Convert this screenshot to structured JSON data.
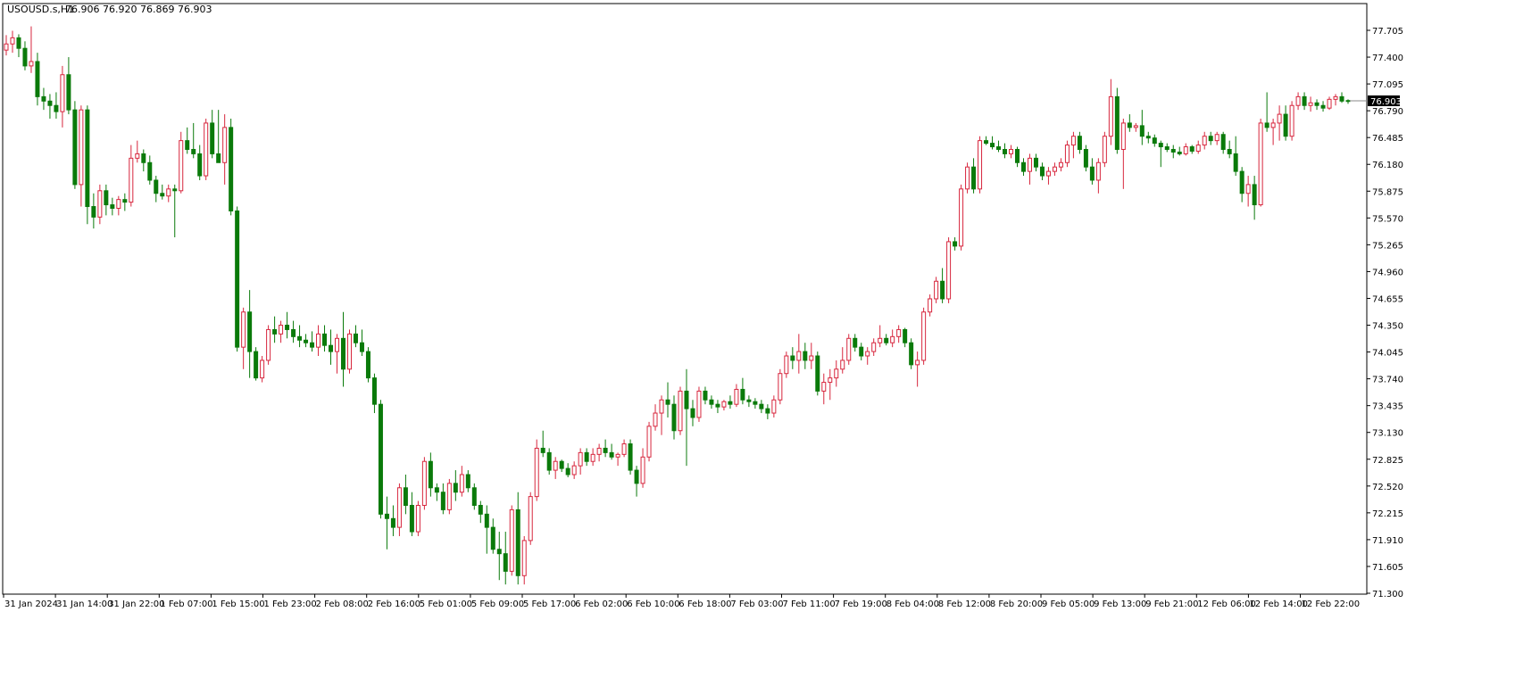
{
  "header": {
    "symbol": "USOUSD.s,H1",
    "ohlc": "76.906 76.920 76.869 76.903"
  },
  "colors": {
    "bull_body": "#ffffff",
    "bull_outline": "#d7263d",
    "bear_body": "#0a7a0a",
    "bear_outline": "#0a7a0a",
    "frame": "#000000",
    "price_tag_bg": "#000000",
    "price_tag_text": "#ffffff"
  },
  "chart_data": {
    "type": "candlestick",
    "title": "USOUSD.s,H1",
    "current_price_label": "76.903",
    "ylim": [
      71.3,
      77.85
    ],
    "grid": false,
    "y_ticks": [
      "77.705",
      "77.400",
      "77.095",
      "76.790",
      "76.485",
      "76.180",
      "75.875",
      "75.570",
      "75.265",
      "74.960",
      "74.655",
      "74.350",
      "74.045",
      "73.740",
      "73.435",
      "73.130",
      "72.825",
      "72.520",
      "72.215",
      "71.910",
      "71.605",
      "71.300"
    ],
    "x_ticks": [
      "31 Jan 2024",
      "31 Jan 14:00",
      "31 Jan 22:00",
      "1 Feb 07:00",
      "1 Feb 15:00",
      "1 Feb 23:00",
      "2 Feb 08:00",
      "2 Feb 16:00",
      "5 Feb 01:00",
      "5 Feb 09:00",
      "5 Feb 17:00",
      "6 Feb 02:00",
      "6 Feb 10:00",
      "6 Feb 18:00",
      "7 Feb 03:00",
      "7 Feb 11:00",
      "7 Feb 19:00",
      "8 Feb 04:00",
      "8 Feb 12:00",
      "8 Feb 20:00",
      "9 Feb 05:00",
      "9 Feb 13:00",
      "9 Feb 21:00",
      "12 Feb 06:00",
      "12 Feb 14:00",
      "12 Feb 22:00"
    ],
    "candles": [
      [
        77.48,
        77.65,
        77.42,
        77.55
      ],
      [
        77.55,
        77.7,
        77.45,
        77.62
      ],
      [
        77.62,
        77.66,
        77.4,
        77.5
      ],
      [
        77.5,
        77.58,
        77.25,
        77.3
      ],
      [
        77.3,
        77.75,
        77.22,
        77.35
      ],
      [
        77.35,
        77.45,
        76.85,
        76.95
      ],
      [
        76.95,
        77.05,
        76.8,
        76.9
      ],
      [
        76.9,
        76.98,
        76.7,
        76.85
      ],
      [
        76.85,
        77.0,
        76.7,
        76.78
      ],
      [
        76.78,
        77.3,
        76.6,
        77.2
      ],
      [
        77.2,
        77.4,
        76.75,
        76.8
      ],
      [
        76.8,
        76.9,
        75.9,
        75.95
      ],
      [
        75.95,
        76.85,
        75.7,
        76.8
      ],
      [
        76.8,
        76.85,
        75.5,
        75.7
      ],
      [
        75.7,
        75.85,
        75.45,
        75.58
      ],
      [
        75.58,
        75.95,
        75.5,
        75.88
      ],
      [
        75.88,
        75.95,
        75.6,
        75.72
      ],
      [
        75.72,
        75.8,
        75.6,
        75.68
      ],
      [
        75.68,
        75.82,
        75.6,
        75.78
      ],
      [
        75.78,
        75.85,
        75.65,
        75.75
      ],
      [
        75.75,
        76.4,
        75.7,
        76.25
      ],
      [
        76.25,
        76.45,
        76.2,
        76.3
      ],
      [
        76.3,
        76.35,
        76.1,
        76.2
      ],
      [
        76.2,
        76.28,
        75.95,
        76.0
      ],
      [
        76.0,
        76.05,
        75.75,
        75.85
      ],
      [
        75.85,
        75.95,
        75.78,
        75.82
      ],
      [
        75.82,
        75.95,
        75.75,
        75.9
      ],
      [
        75.9,
        75.95,
        75.35,
        75.88
      ],
      [
        75.88,
        76.55,
        75.85,
        76.45
      ],
      [
        76.45,
        76.6,
        76.3,
        76.35
      ],
      [
        76.35,
        76.65,
        76.25,
        76.3
      ],
      [
        76.3,
        76.4,
        76.0,
        76.05
      ],
      [
        76.05,
        76.7,
        76.0,
        76.65
      ],
      [
        76.65,
        76.8,
        76.25,
        76.3
      ],
      [
        76.3,
        76.8,
        76.2,
        76.2
      ],
      [
        76.2,
        76.75,
        75.95,
        76.6
      ],
      [
        76.6,
        76.7,
        75.6,
        75.65
      ],
      [
        75.65,
        75.7,
        74.05,
        74.1
      ],
      [
        74.1,
        74.55,
        73.85,
        74.5
      ],
      [
        74.5,
        74.75,
        73.75,
        74.05
      ],
      [
        74.05,
        74.1,
        73.72,
        73.75
      ],
      [
        73.75,
        74.0,
        73.7,
        73.95
      ],
      [
        73.95,
        74.35,
        73.9,
        74.3
      ],
      [
        74.3,
        74.45,
        74.15,
        74.25
      ],
      [
        74.25,
        74.4,
        74.15,
        74.35
      ],
      [
        74.35,
        74.5,
        74.2,
        74.3
      ],
      [
        74.3,
        74.4,
        74.15,
        74.22
      ],
      [
        74.22,
        74.35,
        74.1,
        74.18
      ],
      [
        74.18,
        74.25,
        74.1,
        74.15
      ],
      [
        74.15,
        74.28,
        74.05,
        74.1
      ],
      [
        74.1,
        74.35,
        74.0,
        74.25
      ],
      [
        74.25,
        74.35,
        74.05,
        74.12
      ],
      [
        74.12,
        74.3,
        73.9,
        74.05
      ],
      [
        74.05,
        74.25,
        73.8,
        74.2
      ],
      [
        74.2,
        74.5,
        73.65,
        73.85
      ],
      [
        73.85,
        74.3,
        73.8,
        74.25
      ],
      [
        74.25,
        74.35,
        74.1,
        74.15
      ],
      [
        74.15,
        74.3,
        74.0,
        74.05
      ],
      [
        74.05,
        74.1,
        73.7,
        73.75
      ],
      [
        73.75,
        73.8,
        73.35,
        73.45
      ],
      [
        73.45,
        73.5,
        72.15,
        72.2
      ],
      [
        72.2,
        72.4,
        71.8,
        72.15
      ],
      [
        72.15,
        72.3,
        71.95,
        72.05
      ],
      [
        72.05,
        72.55,
        71.95,
        72.5
      ],
      [
        72.5,
        72.65,
        72.2,
        72.3
      ],
      [
        72.3,
        72.45,
        71.95,
        72.0
      ],
      [
        72.0,
        72.35,
        71.95,
        72.3
      ],
      [
        72.3,
        72.85,
        72.25,
        72.8
      ],
      [
        72.8,
        72.9,
        72.4,
        72.5
      ],
      [
        72.5,
        72.55,
        72.35,
        72.45
      ],
      [
        72.45,
        72.55,
        72.2,
        72.25
      ],
      [
        72.25,
        72.6,
        72.2,
        72.55
      ],
      [
        72.55,
        72.7,
        72.35,
        72.45
      ],
      [
        72.45,
        72.75,
        72.4,
        72.65
      ],
      [
        72.65,
        72.7,
        72.45,
        72.5
      ],
      [
        72.5,
        72.55,
        72.25,
        72.3
      ],
      [
        72.3,
        72.35,
        72.1,
        72.2
      ],
      [
        72.2,
        72.3,
        71.75,
        72.05
      ],
      [
        72.05,
        72.15,
        71.75,
        71.8
      ],
      [
        71.8,
        72.0,
        71.45,
        71.75
      ],
      [
        71.75,
        72.0,
        71.4,
        71.55
      ],
      [
        71.55,
        72.3,
        71.5,
        72.25
      ],
      [
        72.25,
        72.45,
        71.4,
        71.5
      ],
      [
        71.5,
        71.95,
        71.4,
        71.9
      ],
      [
        71.9,
        72.45,
        71.85,
        72.4
      ],
      [
        72.4,
        73.05,
        72.35,
        72.95
      ],
      [
        72.95,
        73.15,
        72.85,
        72.9
      ],
      [
        72.9,
        72.95,
        72.65,
        72.7
      ],
      [
        72.7,
        72.85,
        72.6,
        72.8
      ],
      [
        72.8,
        72.82,
        72.68,
        72.72
      ],
      [
        72.72,
        72.78,
        72.62,
        72.65
      ],
      [
        72.65,
        72.8,
        72.6,
        72.75
      ],
      [
        72.75,
        72.95,
        72.65,
        72.9
      ],
      [
        72.9,
        72.95,
        72.75,
        72.8
      ],
      [
        72.8,
        72.95,
        72.75,
        72.88
      ],
      [
        72.88,
        73.0,
        72.8,
        72.95
      ],
      [
        72.95,
        73.05,
        72.85,
        72.9
      ],
      [
        72.9,
        73.0,
        72.82,
        72.85
      ],
      [
        72.85,
        72.9,
        72.75,
        72.88
      ],
      [
        72.88,
        73.05,
        72.85,
        73.0
      ],
      [
        73.0,
        73.05,
        72.65,
        72.7
      ],
      [
        72.7,
        72.75,
        72.4,
        72.55
      ],
      [
        72.55,
        72.95,
        72.5,
        72.85
      ],
      [
        72.85,
        73.25,
        72.8,
        73.2
      ],
      [
        73.2,
        73.45,
        73.15,
        73.35
      ],
      [
        73.35,
        73.55,
        73.1,
        73.5
      ],
      [
        73.5,
        73.7,
        73.3,
        73.45
      ],
      [
        73.45,
        73.55,
        73.05,
        73.15
      ],
      [
        73.15,
        73.65,
        73.1,
        73.6
      ],
      [
        73.6,
        73.85,
        72.75,
        73.4
      ],
      [
        73.4,
        73.5,
        73.2,
        73.3
      ],
      [
        73.3,
        73.65,
        73.25,
        73.6
      ],
      [
        73.6,
        73.65,
        73.45,
        73.5
      ],
      [
        73.5,
        73.55,
        73.4,
        73.45
      ],
      [
        73.45,
        73.5,
        73.35,
        73.42
      ],
      [
        73.42,
        73.5,
        73.38,
        73.48
      ],
      [
        73.48,
        73.55,
        73.4,
        73.45
      ],
      [
        73.45,
        73.68,
        73.42,
        73.62
      ],
      [
        73.62,
        73.75,
        73.45,
        73.5
      ],
      [
        73.5,
        73.55,
        73.42,
        73.48
      ],
      [
        73.48,
        73.52,
        73.4,
        73.45
      ],
      [
        73.45,
        73.5,
        73.35,
        73.4
      ],
      [
        73.4,
        73.45,
        73.28,
        73.35
      ],
      [
        73.35,
        73.55,
        73.3,
        73.5
      ],
      [
        73.5,
        73.85,
        73.45,
        73.8
      ],
      [
        73.8,
        74.05,
        73.75,
        74.0
      ],
      [
        74.0,
        74.1,
        73.85,
        73.95
      ],
      [
        73.95,
        74.25,
        73.8,
        74.05
      ],
      [
        74.05,
        74.15,
        73.85,
        73.95
      ],
      [
        73.95,
        74.15,
        73.85,
        74.0
      ],
      [
        74.0,
        74.05,
        73.55,
        73.6
      ],
      [
        73.6,
        73.8,
        73.45,
        73.7
      ],
      [
        73.7,
        73.85,
        73.5,
        73.75
      ],
      [
        73.75,
        73.95,
        73.65,
        73.85
      ],
      [
        73.85,
        74.1,
        73.8,
        73.95
      ],
      [
        73.95,
        74.25,
        73.9,
        74.2
      ],
      [
        74.2,
        74.25,
        74.05,
        74.1
      ],
      [
        74.1,
        74.15,
        73.95,
        74.0
      ],
      [
        74.0,
        74.1,
        73.9,
        74.05
      ],
      [
        74.05,
        74.2,
        74.0,
        74.15
      ],
      [
        74.15,
        74.35,
        74.1,
        74.2
      ],
      [
        74.2,
        74.25,
        74.12,
        74.15
      ],
      [
        74.15,
        74.3,
        74.1,
        74.22
      ],
      [
        74.22,
        74.35,
        74.15,
        74.3
      ],
      [
        74.3,
        74.32,
        74.1,
        74.15
      ],
      [
        74.15,
        74.2,
        73.85,
        73.9
      ],
      [
        73.9,
        74.05,
        73.65,
        73.95
      ],
      [
        73.95,
        74.55,
        73.9,
        74.5
      ],
      [
        74.5,
        74.7,
        74.45,
        74.65
      ],
      [
        74.65,
        74.9,
        74.6,
        74.85
      ],
      [
        74.85,
        75.0,
        74.6,
        74.65
      ],
      [
        74.65,
        75.35,
        74.6,
        75.3
      ],
      [
        75.3,
        75.35,
        75.2,
        75.25
      ],
      [
        75.25,
        75.95,
        75.2,
        75.9
      ],
      [
        75.9,
        76.2,
        75.85,
        76.15
      ],
      [
        76.15,
        76.25,
        75.85,
        75.9
      ],
      [
        75.9,
        76.5,
        75.85,
        76.45
      ],
      [
        76.45,
        76.5,
        76.4,
        76.42
      ],
      [
        76.42,
        76.5,
        76.35,
        76.38
      ],
      [
        76.38,
        76.45,
        76.32,
        76.35
      ],
      [
        76.35,
        76.42,
        76.25,
        76.3
      ],
      [
        76.3,
        76.4,
        76.25,
        76.35
      ],
      [
        76.35,
        76.38,
        76.15,
        76.2
      ],
      [
        76.2,
        76.25,
        76.05,
        76.1
      ],
      [
        76.1,
        76.3,
        75.95,
        76.25
      ],
      [
        76.25,
        76.3,
        76.1,
        76.15
      ],
      [
        76.15,
        76.2,
        76.0,
        76.05
      ],
      [
        76.05,
        76.15,
        75.95,
        76.1
      ],
      [
        76.1,
        76.2,
        76.05,
        76.15
      ],
      [
        76.15,
        76.25,
        76.1,
        76.2
      ],
      [
        76.2,
        76.45,
        76.15,
        76.4
      ],
      [
        76.4,
        76.55,
        76.25,
        76.5
      ],
      [
        76.5,
        76.55,
        76.3,
        76.35
      ],
      [
        76.35,
        76.4,
        76.1,
        76.15
      ],
      [
        76.15,
        76.25,
        75.95,
        76.0
      ],
      [
        76.0,
        76.25,
        75.85,
        76.2
      ],
      [
        76.2,
        76.55,
        76.15,
        76.5
      ],
      [
        76.5,
        77.15,
        76.4,
        76.95
      ],
      [
        76.95,
        77.05,
        76.3,
        76.35
      ],
      [
        76.35,
        76.7,
        75.9,
        76.65
      ],
      [
        76.65,
        76.75,
        76.55,
        76.6
      ],
      [
        76.6,
        76.65,
        76.55,
        76.62
      ],
      [
        76.62,
        76.8,
        76.4,
        76.5
      ],
      [
        76.5,
        76.55,
        76.42,
        76.48
      ],
      [
        76.48,
        76.52,
        76.38,
        76.42
      ],
      [
        76.42,
        76.45,
        76.15,
        76.38
      ],
      [
        76.38,
        76.42,
        76.32,
        76.35
      ],
      [
        76.35,
        76.4,
        76.25,
        76.32
      ],
      [
        76.32,
        76.38,
        76.28,
        76.3
      ],
      [
        76.3,
        76.42,
        76.28,
        76.38
      ],
      [
        76.38,
        76.4,
        76.3,
        76.33
      ],
      [
        76.33,
        76.45,
        76.3,
        76.4
      ],
      [
        76.4,
        76.55,
        76.35,
        76.5
      ],
      [
        76.5,
        76.55,
        76.4,
        76.45
      ],
      [
        76.45,
        76.55,
        76.4,
        76.52
      ],
      [
        76.52,
        76.55,
        76.3,
        76.35
      ],
      [
        76.35,
        76.45,
        76.25,
        76.3
      ],
      [
        76.3,
        76.5,
        76.05,
        76.1
      ],
      [
        76.1,
        76.15,
        75.75,
        75.85
      ],
      [
        75.85,
        76.05,
        75.7,
        75.95
      ],
      [
        75.95,
        76.05,
        75.55,
        75.72
      ],
      [
        75.72,
        76.7,
        75.7,
        76.65
      ],
      [
        76.65,
        77.0,
        76.55,
        76.6
      ],
      [
        76.6,
        76.7,
        76.4,
        76.65
      ],
      [
        76.65,
        76.85,
        76.45,
        76.75
      ],
      [
        76.75,
        76.85,
        76.45,
        76.5
      ],
      [
        76.5,
        76.9,
        76.45,
        76.85
      ],
      [
        76.85,
        77.0,
        76.8,
        76.95
      ],
      [
        76.95,
        77.0,
        76.8,
        76.85
      ],
      [
        76.85,
        76.95,
        76.78,
        76.88
      ],
      [
        76.88,
        76.92,
        76.8,
        76.85
      ],
      [
        76.85,
        76.9,
        76.78,
        76.82
      ],
      [
        76.82,
        76.95,
        76.8,
        76.92
      ],
      [
        76.92,
        76.98,
        76.85,
        76.95
      ],
      [
        76.95,
        77.0,
        76.88,
        76.9
      ],
      [
        76.906,
        76.92,
        76.869,
        76.903
      ]
    ]
  }
}
